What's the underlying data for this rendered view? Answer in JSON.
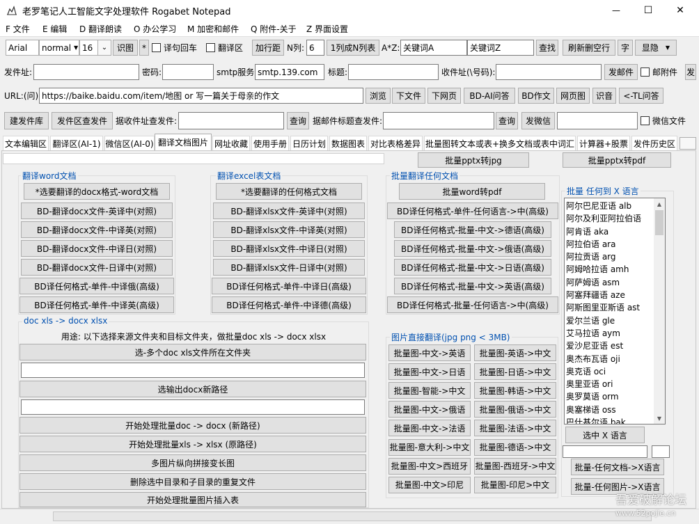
{
  "window": {
    "title": "老罗笔记人工智能文字处理软件 Rogabet Notepad",
    "controls": {
      "minimize": "—",
      "maximize": "☐",
      "close": "✕"
    }
  },
  "menu": [
    "F 文件",
    "E 编辑",
    "D 翻译朗读",
    "O 办公学习",
    "M 加密和邮件",
    "Q 附件-关于",
    "Z 界面设置"
  ],
  "toolbar": {
    "font": "Arial",
    "style": "normal",
    "size": "16",
    "recognize": "识图",
    "star": "*",
    "translate_enter": "译句回车",
    "translate_area": "翻译区",
    "add_row_spacing": "加行距",
    "n_columns_label": "N列:",
    "n_columns_value": "6",
    "to_n_list": "1列成N列表",
    "az_label": "A*Z:",
    "keyword_a": "关键词A",
    "keyword_z": "关键词Z",
    "find": "查找",
    "refresh_remove_blank": "刷新删空行",
    "char": "字",
    "display_hide": "显隐"
  },
  "mail": {
    "sender_label": "发件址:",
    "password_label": "密码:",
    "smtp_label": "smtp服务",
    "smtp_value": "smtp.139.com",
    "subject_label": "标题:",
    "recipient_label": "收件址(\\号码):",
    "send": "发邮件",
    "attachment": "邮附件",
    "extra": "发"
  },
  "url_bar": {
    "label": "URL:(问)",
    "value": "https://baike.baidu.com/item/地图 or 写一篇关于母亲的作文",
    "browse": "浏览",
    "download_file": "下文件",
    "download_page": "下网页",
    "bd_ai_qa": "BD-AI问答",
    "bd_essay": "BD作文",
    "page_image": "网页图",
    "recognize_audio": "识音",
    "tl_qa": "<-TL问答"
  },
  "library": {
    "build": "建发件库",
    "search_sent": "发件区查发件",
    "by_recipient_label": "据收件址查发件:",
    "query1": "查询",
    "by_subject_label": "据邮件标题查发件:",
    "query2": "查询",
    "send_wechat": "发微信",
    "wechat_file": "微信文件"
  },
  "tabs": [
    "文本编辑区",
    "翻译区(AI-1)",
    "微信区(AI-0)",
    "翻译文档图片",
    "网址收藏",
    "使用手册",
    "日历计划",
    "数据图表",
    "对比表格差异",
    "批量图转文本或表+换多文档或表中词汇",
    "计算器+股票",
    "发件历史区"
  ],
  "top_buttons": {
    "pptx_jpg": "批量pptx转jpg",
    "pptx_pdf": "批量pptx转pdf"
  },
  "word_group": {
    "title": "翻译word文档",
    "buttons": [
      "*选要翻译的docx格式-word文档",
      "BD-翻译docx文件-英译中(对照)",
      "BD-翻译docx文件-中译英(对照)",
      "BD-翻译docx文件-中译日(对照)",
      "BD-翻译docx文件-日译中(对照)",
      "BD译任何格式-单件-中译俄(高级)",
      "BD译任何格式-单件-中译英(高级)"
    ]
  },
  "excel_group": {
    "title": "翻译excel表文档",
    "buttons": [
      "*选要翻译的任何格式文档",
      "BD-翻译xlsx文件-英译中(对照)",
      "BD-翻译xlsx文件-中译英(对照)",
      "BD-翻译xlsx文件-中译日(对照)",
      "BD-翻译xlsx文件-日译中(对照)",
      "BD译任何格式-单件-中译日(高级)",
      "BD译任何格式-单件-中译德(高级)"
    ]
  },
  "batch_group": {
    "title": "批量翻译任何文档",
    "buttons": [
      "批量word转pdf",
      "BD译任何格式-单件-任何语言->中(高级)",
      "BD译任何格式-批量-中文->德语(高级)",
      "BD译任何格式-批量-中文->俄语(高级)",
      "BD译任何格式-批量-中文->日语(高级)",
      "BD译任何格式-批量-中文->英语(高级)",
      "BD译任何格式-批量-任何语言->中(高级)"
    ]
  },
  "lang_group": {
    "title": "批量 任何到 X 语言",
    "languages": [
      "阿尔巴尼亚语 alb",
      "阿尔及利亚阿拉伯语",
      "阿肯语 aka",
      "阿拉伯语 ara",
      "阿拉贡语 arg",
      "阿姆哈拉语 amh",
      "阿萨姆语 asm",
      "阿塞拜疆语 aze",
      "阿斯图里亚斯语 ast",
      "爱尔兰语 gle",
      "艾马拉语 aym",
      "爱沙尼亚语 est",
      "奥杰布瓦语 oji",
      "奥克语 oci",
      "奥里亚语 ori",
      "奥罗莫语 orm",
      "奥塞梯语 oss",
      "巴什基尔语 bak"
    ],
    "select": "选中 X 语言",
    "doc_to_x": "批量-任何文档->X语言",
    "img_to_x": "批量-任何图片->X语言"
  },
  "docx_group": {
    "title": "doc xls -> docx xlsx",
    "usage": "用途: 以下选择来源文件夹和目标文件夹，做批量doc xls -> docx xlsx",
    "select_src": "选-多个doc xls文件所在文件夹",
    "select_out": "选输出docx新路径",
    "start_doc": "开始处理批量doc -> docx (新路径)",
    "start_xls": "开始处理批量xls -> xlsx (原路径)",
    "stitch": "多图片纵向拼接变长图",
    "delete_dup": "删除选中目录和子目录的重复文件",
    "insert_table": "开始处理批量图片插入表"
  },
  "image_group": {
    "title": "图片直接翻译(jpg png < 3MB)",
    "left": [
      "批量图-中文->英语",
      "批量图-中文->日语",
      "批量图-智能->中文",
      "批量图-中文->俄语",
      "批量图-中文->法语",
      "批量图-意大利->中文",
      "批量图-中文>西班牙",
      "批量图-中文>印尼"
    ],
    "right": [
      "批量图-英语->中文",
      "批量图-日语->中文",
      "批量图-韩语->中文",
      "批量图-俄语->中文",
      "批量图-法语->中文",
      "批量图-德语->中文",
      "批量图-西班牙->中文",
      "批量图-印尼>中文"
    ]
  },
  "watermark": {
    "main": "吾爱破解论坛",
    "url": "www.52pojie.cn"
  }
}
